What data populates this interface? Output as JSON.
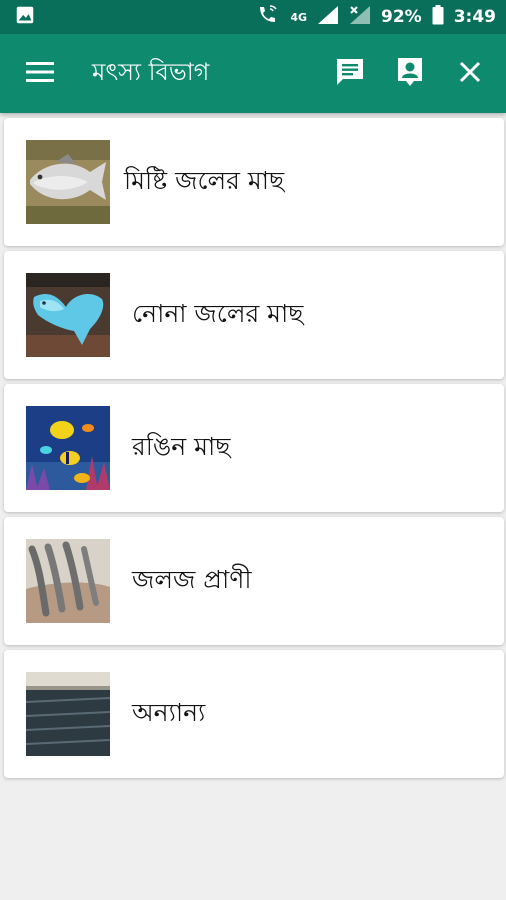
{
  "status_bar": {
    "network": "4G",
    "battery": "92%",
    "time": "3:49",
    "icons": [
      "image-icon",
      "call-wifi-icon",
      "signal-icon",
      "battery-icon"
    ]
  },
  "app_bar": {
    "title": "মৎস্য বিভাগ",
    "actions": [
      "menu-icon",
      "message-icon",
      "contact-icon",
      "close-icon"
    ],
    "color": "#0e8a6f"
  },
  "items": [
    {
      "label": "মিষ্টি জলের মাছ",
      "image": "freshwater-fish-image"
    },
    {
      "label": "নোনা জলের মাছ",
      "image": "saltwater-fish-image"
    },
    {
      "label": "রঙিন মাছ",
      "image": "colorful-fish-image"
    },
    {
      "label": "জলজ প্রাণী",
      "image": "aquatic-animals-image"
    },
    {
      "label": "অন্যান্য",
      "image": "others-image"
    }
  ]
}
